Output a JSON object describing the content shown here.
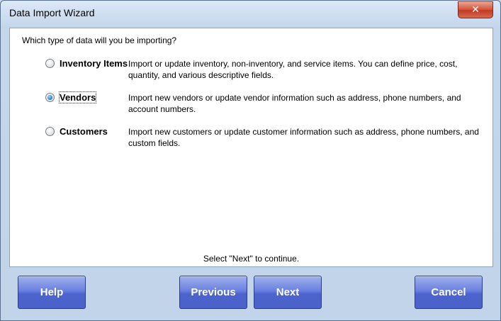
{
  "window": {
    "title": "Data Import Wizard",
    "close_glyph": "✕"
  },
  "prompt": "Which type of data will you be importing?",
  "options": [
    {
      "label": "Inventory Items",
      "description": "Import or update inventory, non-inventory, and service items. You can define price, cost, quantity, and various descriptive fields.",
      "selected": false
    },
    {
      "label": "Vendors",
      "description": "Import new vendors or update vendor information such as address, phone numbers, and account numbers.",
      "selected": true
    },
    {
      "label": "Customers",
      "description": "Import new customers or update customer information such as address, phone numbers, and custom fields.",
      "selected": false
    }
  ],
  "status": "Select \"Next\" to continue.",
  "buttons": {
    "help": "Help",
    "previous": "Previous",
    "next": "Next",
    "cancel": "Cancel"
  }
}
